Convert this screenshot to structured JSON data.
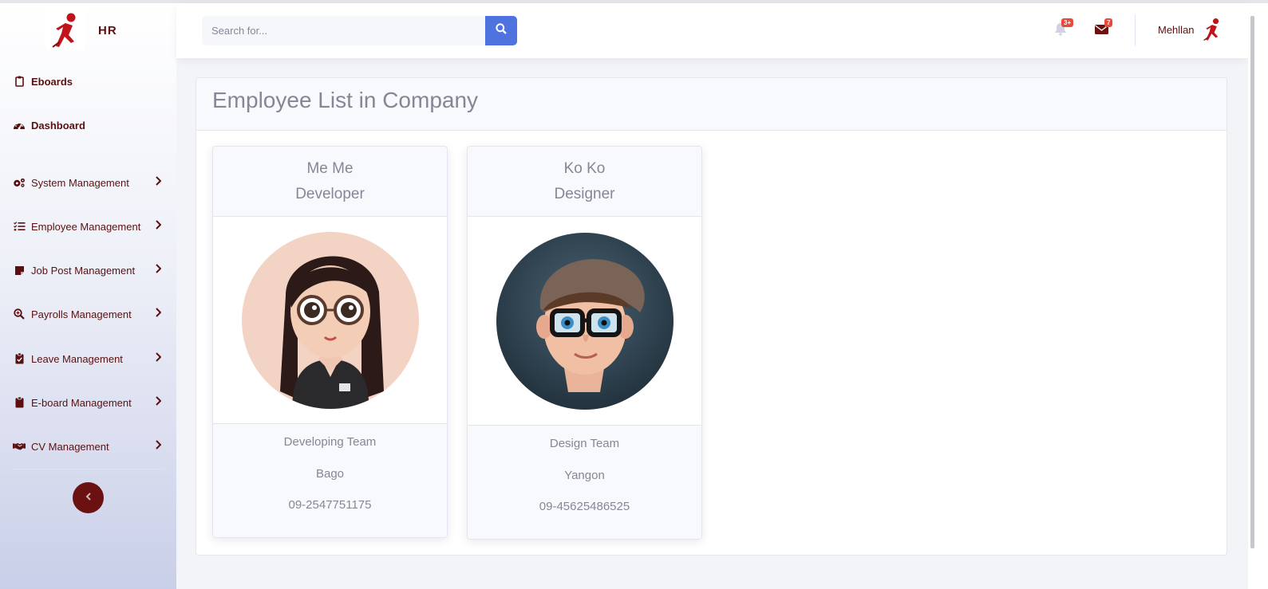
{
  "sidebar": {
    "brand": "HR",
    "items": [
      {
        "label": "Eboards",
        "icon": "clipboard-icon"
      },
      {
        "label": "Dashboard",
        "icon": "tachometer-icon"
      },
      {
        "label": "System Management",
        "icon": "cogs-icon"
      },
      {
        "label": "Employee Management",
        "icon": "tasks-icon"
      },
      {
        "label": "Job Post Management",
        "icon": "sticky-note-icon"
      },
      {
        "label": "Payrolls Management",
        "icon": "search-plus-icon"
      },
      {
        "label": "Leave Management",
        "icon": "clipboard-check-icon"
      },
      {
        "label": "E-board Management",
        "icon": "clipboard-solid-icon"
      },
      {
        "label": "CV Management",
        "icon": "handshake-icon"
      }
    ]
  },
  "topbar": {
    "search_placeholder": "Search for...",
    "alerts_badge": "3+",
    "messages_badge": "7",
    "user_name": "Mehllan"
  },
  "colors": {
    "brand": "#5a1010",
    "primary": "#4e73df",
    "badge": "#e74a3b"
  },
  "main": {
    "title": "Employee List in Company",
    "employees": [
      {
        "name": "Me Me",
        "position": "Developer",
        "team": "Developing Team",
        "location": "Bago",
        "phone": "09-2547751175",
        "avatar": "girl-avatar"
      },
      {
        "name": "Ko Ko",
        "position": "Designer",
        "team": "Design Team",
        "location": "Yangon",
        "phone": "09-45625486525",
        "avatar": "boy-avatar"
      }
    ]
  }
}
